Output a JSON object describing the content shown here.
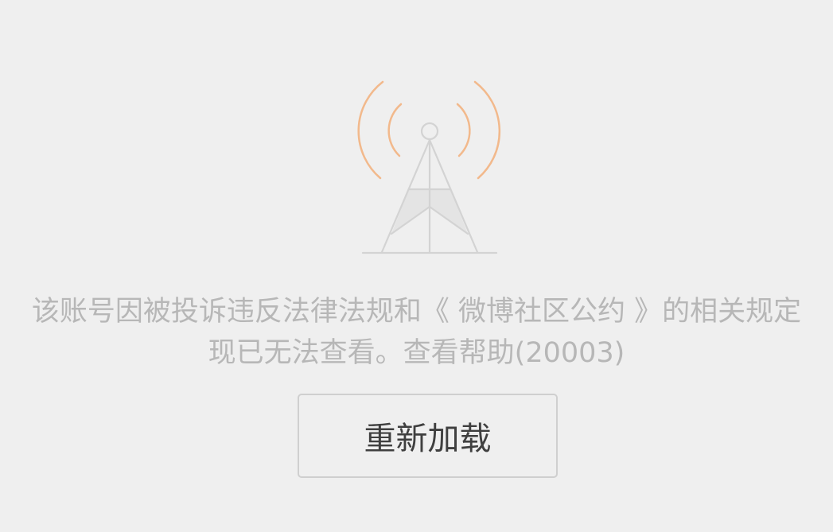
{
  "error": {
    "message_line1": "该账号因被投诉违反法律法规和《 微博社区公约 》的相关规定",
    "message_line2": "现已无法查看。查看帮助(20003)",
    "icon": "signal-tower-icon"
  },
  "actions": {
    "reload_label": "重新加载"
  },
  "colors": {
    "background": "#efefef",
    "text": "#b7b7b7",
    "signal_waves": "#f2b98c",
    "tower": "#d3d3d3"
  }
}
